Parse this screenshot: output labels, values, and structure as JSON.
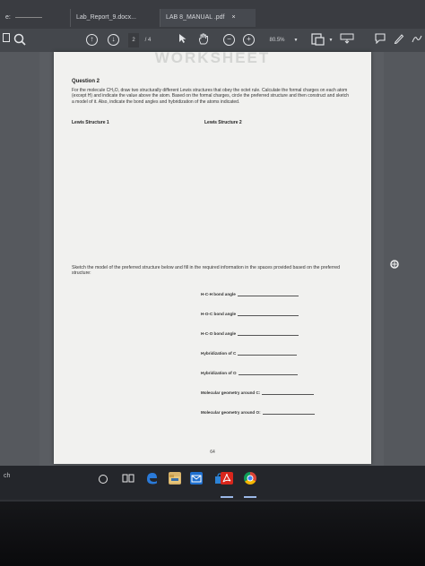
{
  "browser": {
    "left_tab_partial": "e:",
    "tabs": [
      {
        "label": "Lab_Report_9.docx..."
      },
      {
        "label": "LAB 8_MANUAL .pdf",
        "close": "×"
      }
    ]
  },
  "toolbar": {
    "page_current": "2",
    "page_total": "/ 4",
    "zoom": "80.5%"
  },
  "document": {
    "watermark": "WORKSHEET",
    "question_title": "Question 2",
    "question_body": "For the molecule CH₂O, draw two structurally different Lewis structures that obey the octet rule. Calculate the formal charges on each atom (except H) and indicate the value above the atom. Based on the formal charges, circle the preferred structure and then construct and sketch a model of it. Also, indicate the bond angles and hybridization of the atoms indicated.",
    "lewis1": "Lewis Structure 1",
    "lewis2": "Lewis Structure 2",
    "sketch_instructions": "Sketch the model of the preferred structure below and fill in the required information in the spaces provided based on the preferred structure:",
    "fields": [
      "H-C-H bond angle",
      "H-O-C bond angle",
      "H-C-O bond angle",
      "Hybridization of C",
      "Hybridization of O",
      "Molecular geometry around C:",
      "Molecular geometry around O:"
    ],
    "page_number": "64"
  },
  "taskbar": {
    "search_partial": "ch"
  },
  "colors": {
    "acrobat_red": "#d9261c",
    "edge_blue": "#2a7ad9",
    "mail_blue": "#1e6fcf"
  }
}
